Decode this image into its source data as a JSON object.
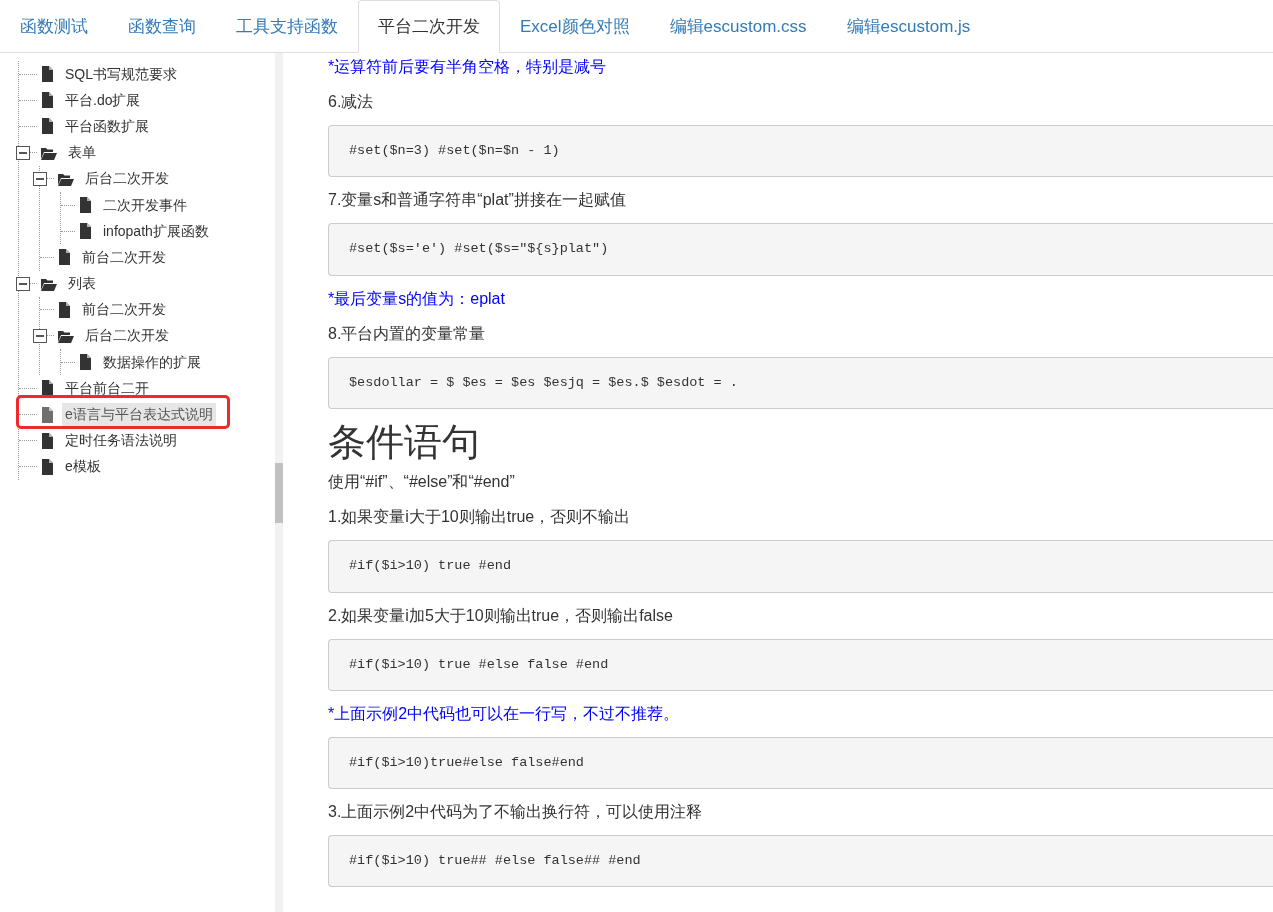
{
  "tabs": [
    {
      "label": "函数测试",
      "selected": false
    },
    {
      "label": "函数查询",
      "selected": false
    },
    {
      "label": "工具支持函数",
      "selected": false
    },
    {
      "label": "平台二次开发",
      "selected": true
    },
    {
      "label": "Excel颜色对照",
      "selected": false
    },
    {
      "label": "编辑escustom.css",
      "selected": false
    },
    {
      "label": "编辑escustom.js",
      "selected": false
    }
  ],
  "tree": [
    {
      "label": "SQL书写规范要求",
      "kind": "file",
      "selected": false
    },
    {
      "label": "平台.do扩展",
      "kind": "file",
      "selected": false
    },
    {
      "label": "平台函数扩展",
      "kind": "file",
      "selected": false
    },
    {
      "label": "表单",
      "kind": "folder",
      "expanded": true,
      "children": [
        {
          "label": "后台二次开发",
          "kind": "folder",
          "expanded": true,
          "children": [
            {
              "label": "二次开发事件",
              "kind": "file",
              "selected": false
            },
            {
              "label": "infopath扩展函数",
              "kind": "file",
              "selected": false
            }
          ]
        },
        {
          "label": "前台二次开发",
          "kind": "file",
          "selected": false
        }
      ]
    },
    {
      "label": "列表",
      "kind": "folder",
      "expanded": true,
      "children": [
        {
          "label": "前台二次开发",
          "kind": "file",
          "selected": false
        },
        {
          "label": "后台二次开发",
          "kind": "folder",
          "expanded": true,
          "children": [
            {
              "label": "数据操作的扩展",
              "kind": "file",
              "selected": false
            }
          ]
        }
      ]
    },
    {
      "label": "平台前台二开",
      "kind": "file",
      "selected": false
    },
    {
      "label": "e语言与平台表达式说明",
      "kind": "file",
      "selected": true
    },
    {
      "label": "定时任务语法说明",
      "kind": "file",
      "selected": false
    },
    {
      "label": "e模板",
      "kind": "file",
      "selected": false
    }
  ],
  "content": [
    {
      "kind": "note",
      "text": "*运算符前后要有半角空格，特别是减号"
    },
    {
      "kind": "para",
      "text": "6.减法"
    },
    {
      "kind": "code",
      "text": "#set($n=3) #set($n=$n - 1)"
    },
    {
      "kind": "para",
      "text": "7.变量s和普通字符串“plat”拼接在一起赋值"
    },
    {
      "kind": "code",
      "text": "#set($s='e') #set($s=\"${s}plat\")"
    },
    {
      "kind": "note",
      "text": "*最后变量s的值为：eplat"
    },
    {
      "kind": "para",
      "text": "8.平台内置的变量常量"
    },
    {
      "kind": "code",
      "text": "$esdollar = $ $es = $es $esjq = $es.$ $esdot = ."
    },
    {
      "kind": "heading",
      "text": "条件语句"
    },
    {
      "kind": "para",
      "text": "使用“#if”、“#else”和“#end”"
    },
    {
      "kind": "para",
      "text": "1.如果变量i大于10则输出true，否则不输出"
    },
    {
      "kind": "code",
      "text": "#if($i>10) true #end"
    },
    {
      "kind": "para",
      "text": "2.如果变量i加5大于10则输出true，否则输出false"
    },
    {
      "kind": "code",
      "text": "#if($i>10) true #else false #end"
    },
    {
      "kind": "note",
      "text": "*上面示例2中代码也可以在一行写，不过不推荐。"
    },
    {
      "kind": "code",
      "text": "#if($i>10)true#else false#end"
    },
    {
      "kind": "para",
      "text": "3.上面示例2中代码为了不输出换行符，可以使用注释"
    },
    {
      "kind": "code",
      "text": "#if($i>10) true## #else false## #end"
    }
  ]
}
